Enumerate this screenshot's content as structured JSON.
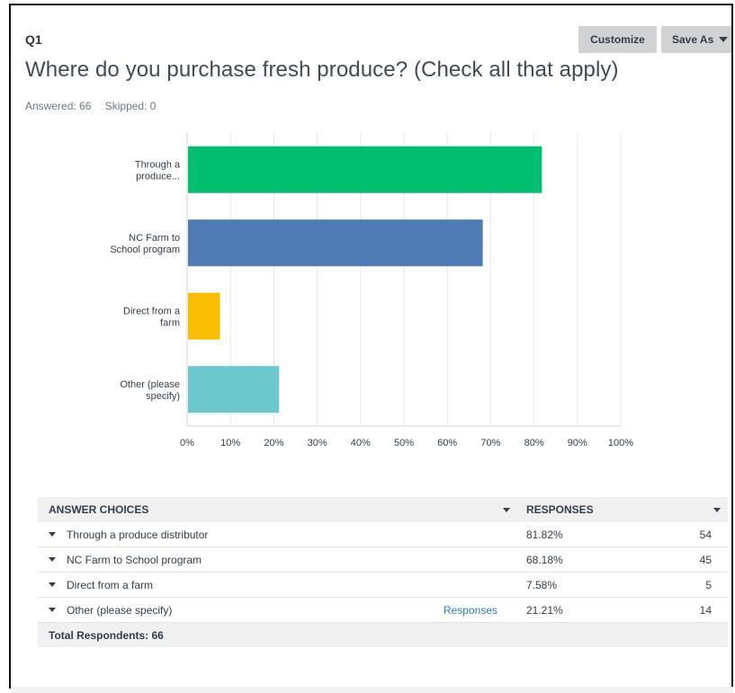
{
  "question": {
    "number": "Q1",
    "title": "Where do you purchase fresh produce? (Check all that apply)",
    "answered": "Answered: 66",
    "skipped": "Skipped: 0"
  },
  "toolbar": {
    "customize_label": "Customize",
    "saveas_label": "Save As"
  },
  "chart_data": {
    "type": "bar",
    "orientation": "horizontal",
    "categories": [
      [
        "Through a",
        "produce..."
      ],
      [
        "NC Farm to",
        "School program"
      ],
      [
        "Direct from a",
        "farm"
      ],
      [
        "Other (please",
        "specify)"
      ]
    ],
    "values": [
      81.82,
      68.18,
      7.58,
      21.21
    ],
    "colors": [
      "#00bf6f",
      "#507cb6",
      "#f9be00",
      "#6bc8cd"
    ],
    "xlim": [
      0,
      100
    ],
    "ticks": [
      "0%",
      "10%",
      "20%",
      "30%",
      "40%",
      "50%",
      "60%",
      "70%",
      "80%",
      "90%",
      "100%"
    ],
    "grid": true
  },
  "table": {
    "header_choices": "ANSWER CHOICES",
    "header_responses": "RESPONSES",
    "rows": [
      {
        "label": "Through a produce distributor",
        "pct": "81.82%",
        "count": "54",
        "link": ""
      },
      {
        "label": "NC Farm to School program",
        "pct": "68.18%",
        "count": "45",
        "link": ""
      },
      {
        "label": "Direct from a farm",
        "pct": "7.58%",
        "count": "5",
        "link": ""
      },
      {
        "label": "Other (please specify)",
        "pct": "21.21%",
        "count": "14",
        "link": "Responses"
      }
    ],
    "total": "Total Respondents: 66"
  }
}
